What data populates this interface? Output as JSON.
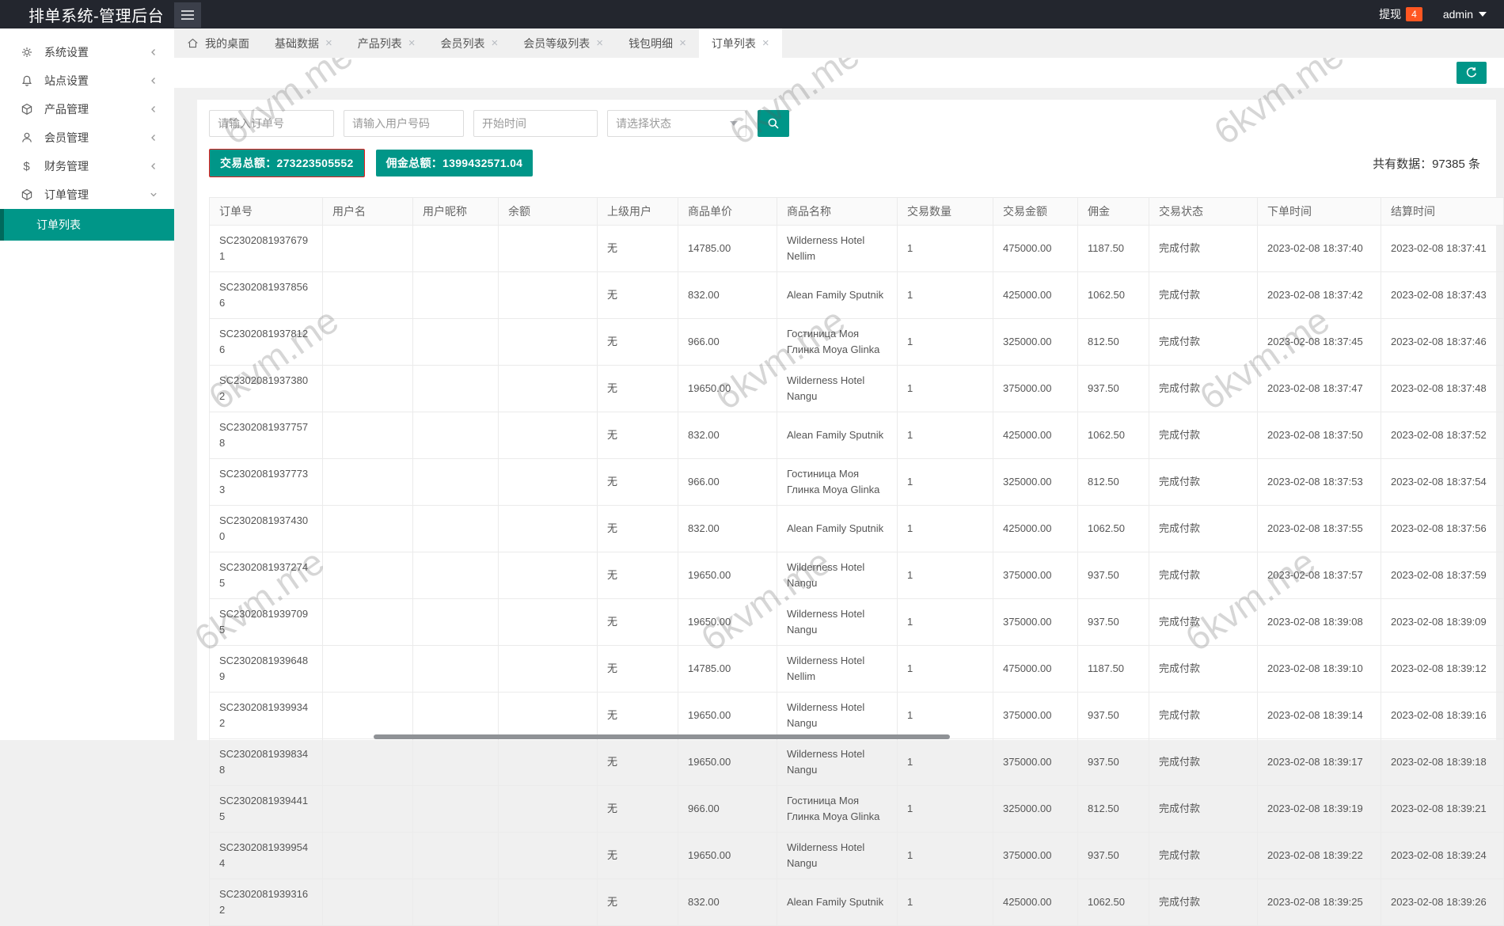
{
  "header": {
    "title": "排单系统-管理后台",
    "withdraw_label": "提现",
    "withdraw_count": "4",
    "username": "admin"
  },
  "sidebar": {
    "items": [
      {
        "label": "系统设置",
        "icon": "gear-icon",
        "expanded": false
      },
      {
        "label": "站点设置",
        "icon": "bell-icon",
        "expanded": false
      },
      {
        "label": "产品管理",
        "icon": "cube-icon",
        "expanded": false
      },
      {
        "label": "会员管理",
        "icon": "user-icon",
        "expanded": false
      },
      {
        "label": "财务管理",
        "icon": "dollar-icon",
        "expanded": false
      },
      {
        "label": "订单管理",
        "icon": "cube-icon",
        "expanded": true
      }
    ],
    "subitems": [
      {
        "label": "订单列表",
        "active": true
      }
    ]
  },
  "tabs": [
    {
      "label": "我的桌面",
      "icon": "home-icon",
      "closable": false,
      "active": false
    },
    {
      "label": "基础数据",
      "closable": true,
      "active": false
    },
    {
      "label": "产品列表",
      "closable": true,
      "active": false
    },
    {
      "label": "会员列表",
      "closable": true,
      "active": false
    },
    {
      "label": "会员等级列表",
      "closable": true,
      "active": false
    },
    {
      "label": "钱包明细",
      "closable": true,
      "active": false
    },
    {
      "label": "订单列表",
      "closable": true,
      "active": true
    }
  ],
  "filters": {
    "order_no_placeholder": "请输入订单号",
    "user_no_placeholder": "请输入用户号码",
    "start_time_placeholder": "开始时间",
    "status_placeholder": "请选择状态"
  },
  "stats": {
    "total_trade": "交易总额：273223505552",
    "total_commission": "佣金总额：1399432571.04",
    "count_label": "共有数据：",
    "count_value": "97385",
    "count_unit": "条"
  },
  "table": {
    "columns": [
      "订单号",
      "用户名",
      "用户昵称",
      "余额",
      "上级用户",
      "商品单价",
      "商品名称",
      "交易数量",
      "交易金额",
      "佣金",
      "交易状态",
      "下单时间",
      "结算时间"
    ],
    "rows": [
      [
        "SC23020819376791",
        "",
        "",
        "",
        "无",
        "14785.00",
        "Wilderness Hotel Nellim",
        "1",
        "475000.00",
        "1187.50",
        "完成付款",
        "2023-02-08 18:37:40",
        "2023-02-08 18:37:41"
      ],
      [
        "SC23020819378566",
        "",
        "",
        "",
        "无",
        "832.00",
        "Alean Family Sputnik",
        "1",
        "425000.00",
        "1062.50",
        "完成付款",
        "2023-02-08 18:37:42",
        "2023-02-08 18:37:43"
      ],
      [
        "SC23020819378126",
        "",
        "",
        "",
        "无",
        "966.00",
        "Гостиница Моя Глинка Moya Glinka",
        "1",
        "325000.00",
        "812.50",
        "完成付款",
        "2023-02-08 18:37:45",
        "2023-02-08 18:37:46"
      ],
      [
        "SC23020819373802",
        "",
        "",
        "",
        "无",
        "19650.00",
        "Wilderness Hotel Nangu",
        "1",
        "375000.00",
        "937.50",
        "完成付款",
        "2023-02-08 18:37:47",
        "2023-02-08 18:37:48"
      ],
      [
        "SC23020819377578",
        "",
        "",
        "",
        "无",
        "832.00",
        "Alean Family Sputnik",
        "1",
        "425000.00",
        "1062.50",
        "完成付款",
        "2023-02-08 18:37:50",
        "2023-02-08 18:37:52"
      ],
      [
        "SC23020819377733",
        "",
        "",
        "",
        "无",
        "966.00",
        "Гостиница Моя Глинка Moya Glinka",
        "1",
        "325000.00",
        "812.50",
        "完成付款",
        "2023-02-08 18:37:53",
        "2023-02-08 18:37:54"
      ],
      [
        "SC23020819374300",
        "",
        "",
        "",
        "无",
        "832.00",
        "Alean Family Sputnik",
        "1",
        "425000.00",
        "1062.50",
        "完成付款",
        "2023-02-08 18:37:55",
        "2023-02-08 18:37:56"
      ],
      [
        "SC23020819372745",
        "",
        "",
        "",
        "无",
        "19650.00",
        "Wilderness Hotel Nangu",
        "1",
        "375000.00",
        "937.50",
        "完成付款",
        "2023-02-08 18:37:57",
        "2023-02-08 18:37:59"
      ],
      [
        "SC23020819397095",
        "",
        "",
        "",
        "无",
        "19650.00",
        "Wilderness Hotel Nangu",
        "1",
        "375000.00",
        "937.50",
        "完成付款",
        "2023-02-08 18:39:08",
        "2023-02-08 18:39:09"
      ],
      [
        "SC23020819396489",
        "",
        "",
        "",
        "无",
        "14785.00",
        "Wilderness Hotel Nellim",
        "1",
        "475000.00",
        "1187.50",
        "完成付款",
        "2023-02-08 18:39:10",
        "2023-02-08 18:39:12"
      ],
      [
        "SC23020819399342",
        "",
        "",
        "",
        "无",
        "19650.00",
        "Wilderness Hotel Nangu",
        "1",
        "375000.00",
        "937.50",
        "完成付款",
        "2023-02-08 18:39:14",
        "2023-02-08 18:39:16"
      ],
      [
        "SC23020819398348",
        "",
        "",
        "",
        "无",
        "19650.00",
        "Wilderness Hotel Nangu",
        "1",
        "375000.00",
        "937.50",
        "完成付款",
        "2023-02-08 18:39:17",
        "2023-02-08 18:39:18"
      ],
      [
        "SC23020819394415",
        "",
        "",
        "",
        "无",
        "966.00",
        "Гостиница Моя Глинка Moya Glinka",
        "1",
        "325000.00",
        "812.50",
        "完成付款",
        "2023-02-08 18:39:19",
        "2023-02-08 18:39:21"
      ],
      [
        "SC23020819399544",
        "",
        "",
        "",
        "无",
        "19650.00",
        "Wilderness Hotel Nangu",
        "1",
        "375000.00",
        "937.50",
        "完成付款",
        "2023-02-08 18:39:22",
        "2023-02-08 18:39:24"
      ],
      [
        "SC23020819393162",
        "",
        "",
        "",
        "无",
        "832.00",
        "Alean Family Sputnik",
        "1",
        "425000.00",
        "1062.50",
        "完成付款",
        "2023-02-08 18:39:25",
        "2023-02-08 18:39:26"
      ]
    ]
  },
  "watermark": {
    "text": "6kvm.me"
  },
  "colors": {
    "accent": "#009688",
    "active_menu_stripe": "#00695c",
    "withdraw_badge": "#FF5722",
    "badge_border_red": "#f01b1b",
    "header_bg": "#23262e"
  }
}
